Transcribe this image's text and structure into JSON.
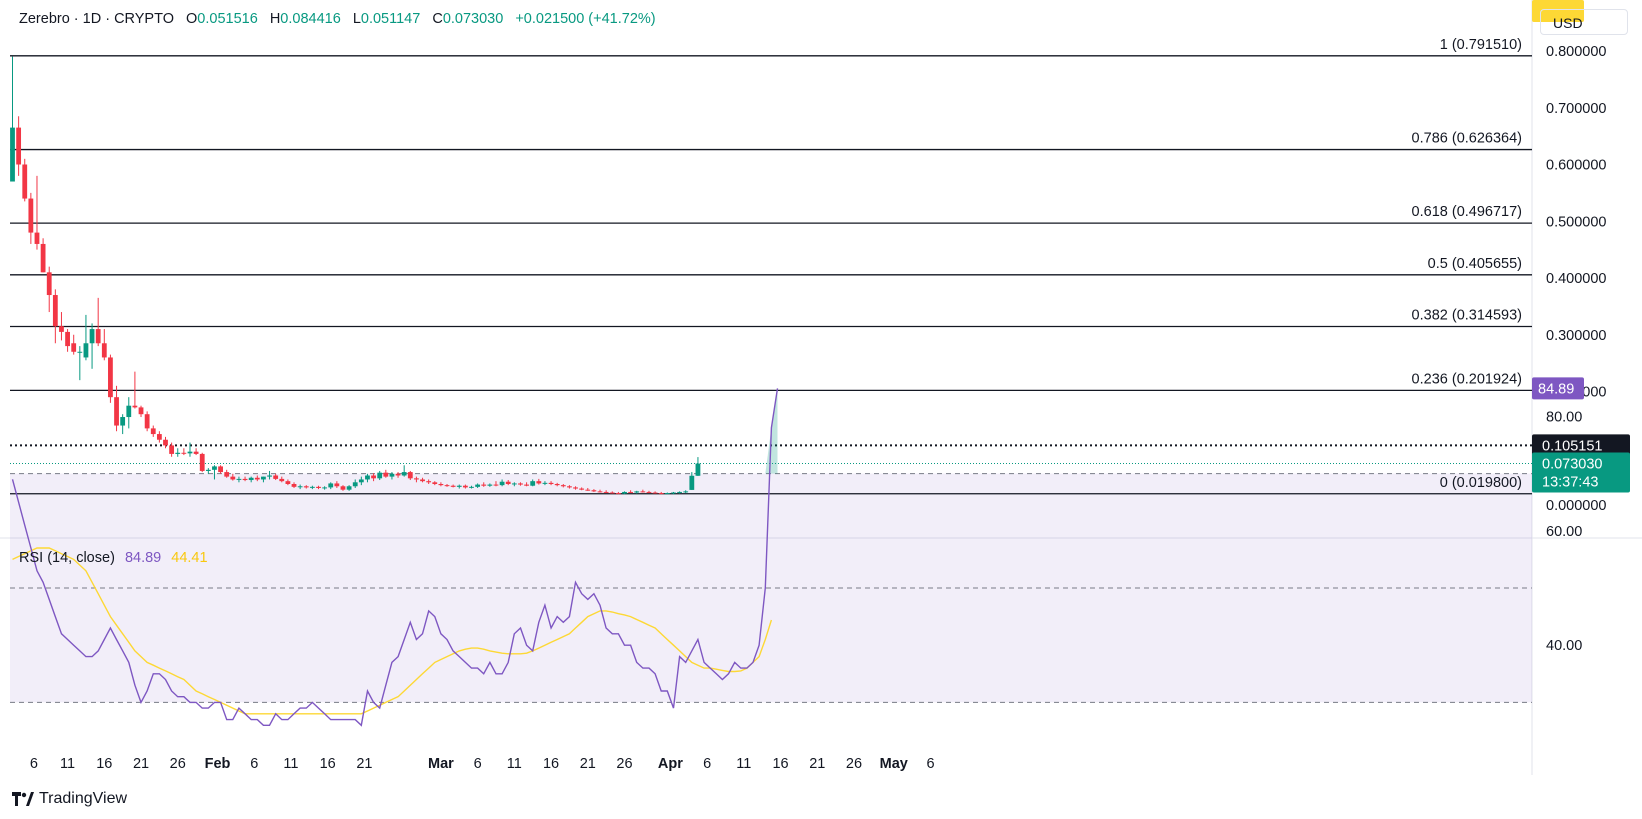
{
  "header": {
    "symbol": "Zerebro · 1D · CRYPTO",
    "open_label": "O",
    "open": "0.051516",
    "high_label": "H",
    "high": "0.084416",
    "low_label": "L",
    "low": "0.051147",
    "close_label": "C",
    "close": "0.073030",
    "change": "+0.021500 (+41.72%)"
  },
  "currency": "USD",
  "brand": "TradingView",
  "colors": {
    "up": "#089981",
    "down": "#f23645",
    "rsi": "#7e57c2",
    "rsi_ma": "#fdd835",
    "fib": "#131722"
  },
  "rsi_header": {
    "label": "RSI (14, close)",
    "value": "84.89",
    "ma_value": "44.41"
  },
  "chart_data": [
    {
      "type": "candlestick",
      "title": "Zerebro · 1D · CRYPTO",
      "x_axis_ticks": [
        "6",
        "11",
        "16",
        "21",
        "26",
        "Feb",
        "6",
        "11",
        "16",
        "21",
        "Mar",
        "6",
        "11",
        "16",
        "21",
        "26",
        "Apr",
        "6",
        "11",
        "16",
        "21",
        "26",
        "May",
        "6"
      ],
      "y_axis_ticks": [
        "0.800000",
        "0.700000",
        "0.600000",
        "0.500000",
        "0.400000",
        "0.300000",
        "0.200000",
        "0.000000"
      ],
      "ylim": [
        0,
        0.8
      ],
      "fibonacci_levels": [
        {
          "label": "1 (0.791510)",
          "value": 0.79151
        },
        {
          "label": "0.786 (0.626364)",
          "value": 0.626364
        },
        {
          "label": "0.618 (0.496717)",
          "value": 0.496717
        },
        {
          "label": "0.5 (0.405655)",
          "value": 0.405655
        },
        {
          "label": "0.382 (0.314593)",
          "value": 0.314593
        },
        {
          "label": "0.236 (0.201924)",
          "value": 0.201924
        },
        {
          "label": "0 (0.019800)",
          "value": 0.0198
        }
      ],
      "price_line": {
        "label": "0.105151",
        "value": 0.105151
      },
      "last_price": {
        "label": "0.073030",
        "countdown": "13:37:43",
        "value": 0.07303
      },
      "candles": [
        {
          "o": 0.57,
          "h": 0.79,
          "l": 0.57,
          "c": 0.665
        },
        {
          "o": 0.665,
          "h": 0.685,
          "l": 0.58,
          "c": 0.6
        },
        {
          "o": 0.6,
          "h": 0.61,
          "l": 0.535,
          "c": 0.54
        },
        {
          "o": 0.54,
          "h": 0.55,
          "l": 0.46,
          "c": 0.48
        },
        {
          "o": 0.48,
          "h": 0.58,
          "l": 0.45,
          "c": 0.46
        },
        {
          "o": 0.46,
          "h": 0.47,
          "l": 0.41,
          "c": 0.41
        },
        {
          "o": 0.41,
          "h": 0.42,
          "l": 0.34,
          "c": 0.37
        },
        {
          "o": 0.37,
          "h": 0.38,
          "l": 0.285,
          "c": 0.315
        },
        {
          "o": 0.315,
          "h": 0.34,
          "l": 0.29,
          "c": 0.305
        },
        {
          "o": 0.305,
          "h": 0.31,
          "l": 0.27,
          "c": 0.28
        },
        {
          "o": 0.285,
          "h": 0.3,
          "l": 0.265,
          "c": 0.27
        },
        {
          "o": 0.27,
          "h": 0.28,
          "l": 0.22,
          "c": 0.27
        },
        {
          "o": 0.26,
          "h": 0.335,
          "l": 0.255,
          "c": 0.285
        },
        {
          "o": 0.285,
          "h": 0.32,
          "l": 0.24,
          "c": 0.31
        },
        {
          "o": 0.31,
          "h": 0.365,
          "l": 0.28,
          "c": 0.285
        },
        {
          "o": 0.285,
          "h": 0.31,
          "l": 0.255,
          "c": 0.26
        },
        {
          "o": 0.26,
          "h": 0.265,
          "l": 0.18,
          "c": 0.19
        },
        {
          "o": 0.19,
          "h": 0.21,
          "l": 0.13,
          "c": 0.14
        },
        {
          "o": 0.14,
          "h": 0.16,
          "l": 0.125,
          "c": 0.155
        },
        {
          "o": 0.155,
          "h": 0.19,
          "l": 0.135,
          "c": 0.175
        },
        {
          "o": 0.175,
          "h": 0.235,
          "l": 0.17,
          "c": 0.172
        },
        {
          "o": 0.172,
          "h": 0.175,
          "l": 0.155,
          "c": 0.16
        },
        {
          "o": 0.16,
          "h": 0.165,
          "l": 0.13,
          "c": 0.135
        },
        {
          "o": 0.135,
          "h": 0.14,
          "l": 0.12,
          "c": 0.125
        },
        {
          "o": 0.125,
          "h": 0.13,
          "l": 0.11,
          "c": 0.115
        },
        {
          "o": 0.115,
          "h": 0.12,
          "l": 0.1,
          "c": 0.105
        },
        {
          "o": 0.105,
          "h": 0.11,
          "l": 0.085,
          "c": 0.09
        },
        {
          "o": 0.09,
          "h": 0.1,
          "l": 0.085,
          "c": 0.092
        },
        {
          "o": 0.092,
          "h": 0.1,
          "l": 0.088,
          "c": 0.091
        },
        {
          "o": 0.091,
          "h": 0.11,
          "l": 0.085,
          "c": 0.094
        },
        {
          "o": 0.094,
          "h": 0.1,
          "l": 0.088,
          "c": 0.09
        },
        {
          "o": 0.09,
          "h": 0.092,
          "l": 0.058,
          "c": 0.06
        },
        {
          "o": 0.06,
          "h": 0.065,
          "l": 0.055,
          "c": 0.062
        },
        {
          "o": 0.062,
          "h": 0.07,
          "l": 0.045,
          "c": 0.068
        },
        {
          "o": 0.068,
          "h": 0.07,
          "l": 0.055,
          "c": 0.058
        },
        {
          "o": 0.058,
          "h": 0.062,
          "l": 0.048,
          "c": 0.05
        },
        {
          "o": 0.05,
          "h": 0.055,
          "l": 0.043,
          "c": 0.045
        },
        {
          "o": 0.045,
          "h": 0.05,
          "l": 0.04,
          "c": 0.046
        },
        {
          "o": 0.046,
          "h": 0.05,
          "l": 0.042,
          "c": 0.044
        },
        {
          "o": 0.044,
          "h": 0.05,
          "l": 0.04,
          "c": 0.048
        },
        {
          "o": 0.048,
          "h": 0.052,
          "l": 0.042,
          "c": 0.045
        },
        {
          "o": 0.045,
          "h": 0.05,
          "l": 0.04,
          "c": 0.05
        },
        {
          "o": 0.05,
          "h": 0.06,
          "l": 0.045,
          "c": 0.052
        },
        {
          "o": 0.052,
          "h": 0.055,
          "l": 0.044,
          "c": 0.046
        },
        {
          "o": 0.046,
          "h": 0.05,
          "l": 0.04,
          "c": 0.042
        },
        {
          "o": 0.042,
          "h": 0.045,
          "l": 0.035,
          "c": 0.037
        },
        {
          "o": 0.037,
          "h": 0.04,
          "l": 0.03,
          "c": 0.032
        },
        {
          "o": 0.032,
          "h": 0.036,
          "l": 0.028,
          "c": 0.033
        },
        {
          "o": 0.033,
          "h": 0.035,
          "l": 0.029,
          "c": 0.031
        },
        {
          "o": 0.031,
          "h": 0.034,
          "l": 0.028,
          "c": 0.032
        },
        {
          "o": 0.032,
          "h": 0.034,
          "l": 0.028,
          "c": 0.03
        },
        {
          "o": 0.03,
          "h": 0.033,
          "l": 0.027,
          "c": 0.031
        },
        {
          "o": 0.031,
          "h": 0.04,
          "l": 0.028,
          "c": 0.038
        },
        {
          "o": 0.038,
          "h": 0.042,
          "l": 0.03,
          "c": 0.033
        },
        {
          "o": 0.033,
          "h": 0.035,
          "l": 0.025,
          "c": 0.027
        },
        {
          "o": 0.027,
          "h": 0.035,
          "l": 0.025,
          "c": 0.033
        },
        {
          "o": 0.033,
          "h": 0.045,
          "l": 0.03,
          "c": 0.04
        },
        {
          "o": 0.04,
          "h": 0.05,
          "l": 0.035,
          "c": 0.045
        },
        {
          "o": 0.045,
          "h": 0.055,
          "l": 0.04,
          "c": 0.052
        },
        {
          "o": 0.052,
          "h": 0.056,
          "l": 0.042,
          "c": 0.047
        },
        {
          "o": 0.047,
          "h": 0.06,
          "l": 0.044,
          "c": 0.057
        },
        {
          "o": 0.057,
          "h": 0.062,
          "l": 0.048,
          "c": 0.05
        },
        {
          "o": 0.05,
          "h": 0.058,
          "l": 0.045,
          "c": 0.055
        },
        {
          "o": 0.055,
          "h": 0.058,
          "l": 0.048,
          "c": 0.052
        },
        {
          "o": 0.052,
          "h": 0.07,
          "l": 0.05,
          "c": 0.058
        },
        {
          "o": 0.058,
          "h": 0.06,
          "l": 0.044,
          "c": 0.047
        },
        {
          "o": 0.047,
          "h": 0.05,
          "l": 0.04,
          "c": 0.045
        },
        {
          "o": 0.045,
          "h": 0.048,
          "l": 0.04,
          "c": 0.042
        },
        {
          "o": 0.042,
          "h": 0.045,
          "l": 0.037,
          "c": 0.04
        },
        {
          "o": 0.04,
          "h": 0.042,
          "l": 0.035,
          "c": 0.037
        },
        {
          "o": 0.037,
          "h": 0.04,
          "l": 0.033,
          "c": 0.035
        },
        {
          "o": 0.035,
          "h": 0.037,
          "l": 0.032,
          "c": 0.034
        },
        {
          "o": 0.034,
          "h": 0.036,
          "l": 0.031,
          "c": 0.032
        },
        {
          "o": 0.032,
          "h": 0.036,
          "l": 0.029,
          "c": 0.034
        },
        {
          "o": 0.034,
          "h": 0.036,
          "l": 0.029,
          "c": 0.031
        },
        {
          "o": 0.031,
          "h": 0.034,
          "l": 0.029,
          "c": 0.032
        },
        {
          "o": 0.032,
          "h": 0.038,
          "l": 0.03,
          "c": 0.036
        },
        {
          "o": 0.036,
          "h": 0.04,
          "l": 0.032,
          "c": 0.034
        },
        {
          "o": 0.034,
          "h": 0.038,
          "l": 0.032,
          "c": 0.036
        },
        {
          "o": 0.036,
          "h": 0.042,
          "l": 0.033,
          "c": 0.035
        },
        {
          "o": 0.035,
          "h": 0.045,
          "l": 0.033,
          "c": 0.041
        },
        {
          "o": 0.041,
          "h": 0.044,
          "l": 0.035,
          "c": 0.037
        },
        {
          "o": 0.037,
          "h": 0.04,
          "l": 0.033,
          "c": 0.038
        },
        {
          "o": 0.038,
          "h": 0.04,
          "l": 0.034,
          "c": 0.036
        },
        {
          "o": 0.036,
          "h": 0.04,
          "l": 0.033,
          "c": 0.034
        },
        {
          "o": 0.034,
          "h": 0.045,
          "l": 0.033,
          "c": 0.042
        },
        {
          "o": 0.042,
          "h": 0.046,
          "l": 0.036,
          "c": 0.038
        },
        {
          "o": 0.038,
          "h": 0.042,
          "l": 0.035,
          "c": 0.039
        },
        {
          "o": 0.039,
          "h": 0.042,
          "l": 0.035,
          "c": 0.037
        },
        {
          "o": 0.037,
          "h": 0.039,
          "l": 0.033,
          "c": 0.035
        },
        {
          "o": 0.035,
          "h": 0.037,
          "l": 0.031,
          "c": 0.033
        },
        {
          "o": 0.033,
          "h": 0.035,
          "l": 0.029,
          "c": 0.031
        },
        {
          "o": 0.031,
          "h": 0.033,
          "l": 0.027,
          "c": 0.029
        },
        {
          "o": 0.029,
          "h": 0.031,
          "l": 0.026,
          "c": 0.027
        },
        {
          "o": 0.027,
          "h": 0.03,
          "l": 0.025,
          "c": 0.026
        },
        {
          "o": 0.026,
          "h": 0.028,
          "l": 0.023,
          "c": 0.024
        },
        {
          "o": 0.024,
          "h": 0.027,
          "l": 0.022,
          "c": 0.023
        },
        {
          "o": 0.023,
          "h": 0.026,
          "l": 0.021,
          "c": 0.022
        },
        {
          "o": 0.022,
          "h": 0.024,
          "l": 0.02,
          "c": 0.021
        },
        {
          "o": 0.021,
          "h": 0.023,
          "l": 0.019,
          "c": 0.02
        },
        {
          "o": 0.02,
          "h": 0.024,
          "l": 0.019,
          "c": 0.023
        },
        {
          "o": 0.023,
          "h": 0.026,
          "l": 0.021,
          "c": 0.022
        },
        {
          "o": 0.022,
          "h": 0.025,
          "l": 0.02,
          "c": 0.024
        },
        {
          "o": 0.024,
          "h": 0.027,
          "l": 0.022,
          "c": 0.023
        },
        {
          "o": 0.023,
          "h": 0.025,
          "l": 0.021,
          "c": 0.022
        },
        {
          "o": 0.022,
          "h": 0.024,
          "l": 0.02,
          "c": 0.021
        },
        {
          "o": 0.021,
          "h": 0.023,
          "l": 0.019,
          "c": 0.02
        },
        {
          "o": 0.02,
          "h": 0.022,
          "l": 0.019,
          "c": 0.021
        },
        {
          "o": 0.021,
          "h": 0.023,
          "l": 0.019,
          "c": 0.022
        },
        {
          "o": 0.022,
          "h": 0.024,
          "l": 0.02,
          "c": 0.023
        },
        {
          "o": 0.023,
          "h": 0.026,
          "l": 0.021,
          "c": 0.024
        },
        {
          "o": 0.0266,
          "h": 0.058,
          "l": 0.0266,
          "c": 0.0515
        },
        {
          "o": 0.051516,
          "h": 0.084416,
          "l": 0.051147,
          "c": 0.07303
        }
      ]
    },
    {
      "type": "line",
      "title": "RSI (14, close)",
      "y_axis_ticks": [
        "80.00",
        "60.00",
        "40.00"
      ],
      "ylim": [
        23,
        88
      ],
      "bands": {
        "upper": 70,
        "middle": 50,
        "lower": 30
      },
      "last_value_label": "84.89",
      "last_ma_label": "44.41",
      "series": [
        {
          "name": "RSI",
          "values": [
            69,
            65,
            61,
            57,
            53,
            51,
            48,
            45,
            42,
            41,
            40,
            39,
            38,
            38,
            39,
            41,
            43,
            41,
            39,
            37,
            33,
            30,
            32,
            35,
            35,
            34,
            32,
            31,
            31,
            30,
            30,
            29,
            29,
            30,
            30,
            27,
            27,
            29,
            28,
            27,
            27,
            26,
            26,
            28,
            27,
            27,
            28,
            29,
            29,
            30,
            29,
            28,
            27,
            27,
            27,
            27,
            27,
            26,
            32,
            30,
            29,
            33,
            37,
            38,
            41,
            44,
            41,
            42,
            46,
            45,
            42,
            41,
            39,
            38,
            37,
            36,
            36,
            35,
            37,
            35,
            35,
            37,
            42,
            43,
            40,
            39,
            44,
            47,
            43,
            45,
            44,
            45,
            51,
            49,
            48,
            49,
            47,
            43,
            42,
            42,
            40,
            40,
            37,
            36,
            36,
            35,
            32,
            32,
            29,
            38,
            37,
            39,
            41,
            37,
            36,
            35,
            34,
            35,
            37,
            36,
            36,
            37,
            40,
            50,
            78,
            84.89
          ]
        },
        {
          "name": "RSI-based MA",
          "values": [
            55,
            55.5,
            56,
            56.5,
            57,
            57,
            57,
            56.5,
            56,
            55.5,
            55,
            54,
            53,
            51,
            49,
            47,
            45,
            43.5,
            42,
            40.5,
            39,
            38,
            37,
            36.5,
            36,
            35.5,
            35,
            34.5,
            34,
            33,
            32,
            31.5,
            31,
            30.5,
            30,
            29.5,
            29,
            28.5,
            28,
            28,
            28,
            28,
            28,
            28,
            28,
            28,
            28,
            28,
            28,
            28,
            28,
            28,
            28,
            28,
            28,
            28,
            28,
            28,
            28.5,
            29,
            29.5,
            30,
            30.5,
            31,
            32,
            33,
            34,
            35,
            36,
            37,
            37.5,
            38,
            38.5,
            39,
            39.3,
            39.5,
            39.5,
            39.3,
            39,
            38.8,
            38.6,
            38.5,
            38.5,
            38.5,
            38.6,
            39,
            39.5,
            40,
            40.5,
            41,
            41.5,
            42,
            43,
            44,
            45,
            45.5,
            46,
            46,
            45.8,
            45.5,
            45.3,
            45,
            44.5,
            44,
            43.5,
            43,
            42,
            41,
            40,
            39,
            38,
            37,
            36.5,
            36,
            36,
            35.8,
            35.6,
            35.4,
            35.4,
            35.5,
            36,
            37,
            38,
            41,
            44.41
          ]
        }
      ]
    }
  ]
}
